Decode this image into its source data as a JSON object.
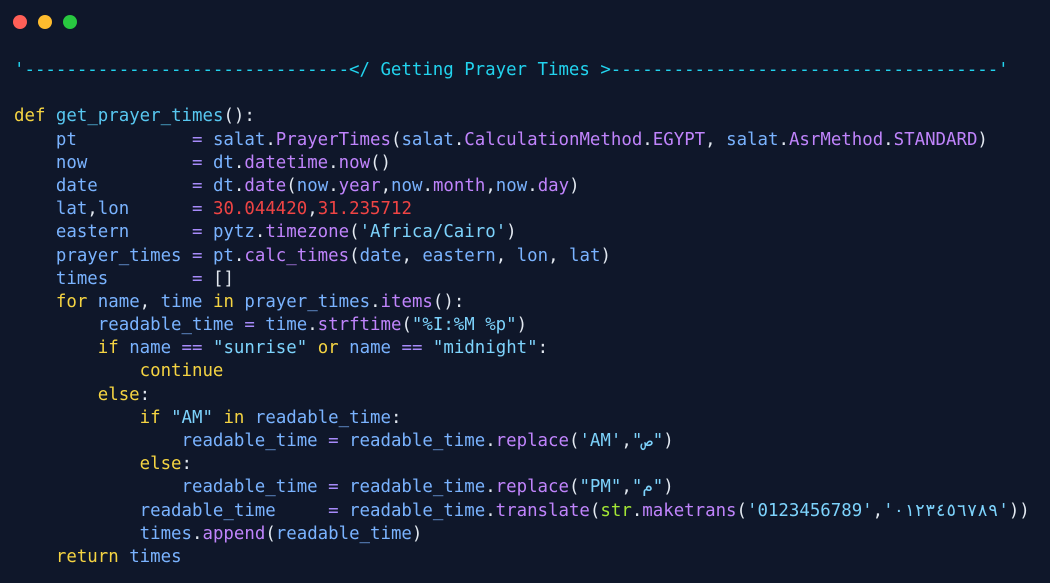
{
  "window": {
    "background": "#0f172a",
    "controls": [
      {
        "name": "close",
        "color": "#ff5f57"
      },
      {
        "name": "minimize",
        "color": "#febc2e"
      },
      {
        "name": "maximize",
        "color": "#28c840"
      }
    ]
  },
  "colors": {
    "keyword": "#f5d442",
    "function": "#58c7f0",
    "name": "#7ab3ff",
    "member": "#c084fc",
    "string": "#7dd3fc",
    "number": "#ef4444",
    "punct": "#e2e8f0",
    "operator": "#a78bfa",
    "builtin": "#a3e635",
    "banner": "#22d3ee"
  },
  "code": {
    "language": "python",
    "lines": [
      [
        [
          "banner",
          "'-------------------------------</ Getting Prayer Times >-------------------------------------'"
        ]
      ],
      [],
      [
        [
          "keyword",
          "def"
        ],
        [
          "name",
          " "
        ],
        [
          "function",
          "get_prayer_times"
        ],
        [
          "punct",
          "():"
        ]
      ],
      [
        [
          "name",
          "    pt           "
        ],
        [
          "operator",
          "="
        ],
        [
          "name",
          " salat"
        ],
        [
          "punct",
          "."
        ],
        [
          "member",
          "PrayerTimes"
        ],
        [
          "punct",
          "("
        ],
        [
          "name",
          "salat"
        ],
        [
          "punct",
          "."
        ],
        [
          "member",
          "CalculationMethod"
        ],
        [
          "punct",
          "."
        ],
        [
          "member",
          "EGYPT"
        ],
        [
          "punct",
          ", "
        ],
        [
          "name",
          "salat"
        ],
        [
          "punct",
          "."
        ],
        [
          "member",
          "AsrMethod"
        ],
        [
          "punct",
          "."
        ],
        [
          "member",
          "STANDARD"
        ],
        [
          "punct",
          ")"
        ]
      ],
      [
        [
          "name",
          "    now          "
        ],
        [
          "operator",
          "="
        ],
        [
          "name",
          " dt"
        ],
        [
          "punct",
          "."
        ],
        [
          "member",
          "datetime"
        ],
        [
          "punct",
          "."
        ],
        [
          "member",
          "now"
        ],
        [
          "punct",
          "()"
        ]
      ],
      [
        [
          "name",
          "    date         "
        ],
        [
          "operator",
          "="
        ],
        [
          "name",
          " dt"
        ],
        [
          "punct",
          "."
        ],
        [
          "member",
          "date"
        ],
        [
          "punct",
          "("
        ],
        [
          "name",
          "now"
        ],
        [
          "punct",
          "."
        ],
        [
          "member",
          "year"
        ],
        [
          "punct",
          ","
        ],
        [
          "name",
          "now"
        ],
        [
          "punct",
          "."
        ],
        [
          "member",
          "month"
        ],
        [
          "punct",
          ","
        ],
        [
          "name",
          "now"
        ],
        [
          "punct",
          "."
        ],
        [
          "member",
          "day"
        ],
        [
          "punct",
          ")"
        ]
      ],
      [
        [
          "name",
          "    lat"
        ],
        [
          "punct",
          ","
        ],
        [
          "name",
          "lon      "
        ],
        [
          "operator",
          "="
        ],
        [
          "name",
          " "
        ],
        [
          "number",
          "30.044420"
        ],
        [
          "punct",
          ","
        ],
        [
          "number",
          "31.235712"
        ]
      ],
      [
        [
          "name",
          "    eastern      "
        ],
        [
          "operator",
          "="
        ],
        [
          "name",
          " pytz"
        ],
        [
          "punct",
          "."
        ],
        [
          "member",
          "timezone"
        ],
        [
          "punct",
          "("
        ],
        [
          "string",
          "'Africa/Cairo'"
        ],
        [
          "punct",
          ")"
        ]
      ],
      [
        [
          "name",
          "    prayer_times "
        ],
        [
          "operator",
          "="
        ],
        [
          "name",
          " pt"
        ],
        [
          "punct",
          "."
        ],
        [
          "member",
          "calc_times"
        ],
        [
          "punct",
          "("
        ],
        [
          "name",
          "date"
        ],
        [
          "punct",
          ", "
        ],
        [
          "name",
          "eastern"
        ],
        [
          "punct",
          ", "
        ],
        [
          "name",
          "lon"
        ],
        [
          "punct",
          ", "
        ],
        [
          "name",
          "lat"
        ],
        [
          "punct",
          ")"
        ]
      ],
      [
        [
          "name",
          "    times        "
        ],
        [
          "operator",
          "="
        ],
        [
          "name",
          " "
        ],
        [
          "punct",
          "[]"
        ]
      ],
      [
        [
          "name",
          "    "
        ],
        [
          "keyword",
          "for"
        ],
        [
          "name",
          " name"
        ],
        [
          "punct",
          ", "
        ],
        [
          "name",
          "time "
        ],
        [
          "keyword",
          "in"
        ],
        [
          "name",
          " prayer_times"
        ],
        [
          "punct",
          "."
        ],
        [
          "member",
          "items"
        ],
        [
          "punct",
          "():"
        ]
      ],
      [
        [
          "name",
          "        readable_time "
        ],
        [
          "operator",
          "="
        ],
        [
          "name",
          " time"
        ],
        [
          "punct",
          "."
        ],
        [
          "member",
          "strftime"
        ],
        [
          "punct",
          "("
        ],
        [
          "string",
          "\"%I:%M %p\""
        ],
        [
          "punct",
          ")"
        ]
      ],
      [
        [
          "name",
          "        "
        ],
        [
          "keyword",
          "if"
        ],
        [
          "name",
          " name "
        ],
        [
          "operator",
          "=="
        ],
        [
          "name",
          " "
        ],
        [
          "string",
          "\"sunrise\""
        ],
        [
          "name",
          " "
        ],
        [
          "keyword",
          "or"
        ],
        [
          "name",
          " name "
        ],
        [
          "operator",
          "=="
        ],
        [
          "name",
          " "
        ],
        [
          "string",
          "\"midnight\""
        ],
        [
          "punct",
          ":"
        ]
      ],
      [
        [
          "name",
          "            "
        ],
        [
          "keyword",
          "continue"
        ]
      ],
      [
        [
          "name",
          "        "
        ],
        [
          "keyword",
          "else"
        ],
        [
          "punct",
          ":"
        ]
      ],
      [
        [
          "name",
          "            "
        ],
        [
          "keyword",
          "if"
        ],
        [
          "name",
          " "
        ],
        [
          "string",
          "\"AM\""
        ],
        [
          "name",
          " "
        ],
        [
          "keyword",
          "in"
        ],
        [
          "name",
          " readable_time"
        ],
        [
          "punct",
          ":"
        ]
      ],
      [
        [
          "name",
          "                readable_time "
        ],
        [
          "operator",
          "="
        ],
        [
          "name",
          " readable_time"
        ],
        [
          "punct",
          "."
        ],
        [
          "member",
          "replace"
        ],
        [
          "punct",
          "("
        ],
        [
          "string",
          "'AM'"
        ],
        [
          "punct",
          ","
        ],
        [
          "string",
          "\"ص\""
        ],
        [
          "punct",
          ")"
        ]
      ],
      [
        [
          "name",
          "            "
        ],
        [
          "keyword",
          "else"
        ],
        [
          "punct",
          ":"
        ]
      ],
      [
        [
          "name",
          "                readable_time "
        ],
        [
          "operator",
          "="
        ],
        [
          "name",
          " readable_time"
        ],
        [
          "punct",
          "."
        ],
        [
          "member",
          "replace"
        ],
        [
          "punct",
          "("
        ],
        [
          "string",
          "\"PM\""
        ],
        [
          "punct",
          ","
        ],
        [
          "string",
          "\"م\""
        ],
        [
          "punct",
          ")"
        ]
      ],
      [
        [
          "name",
          "            readable_time     "
        ],
        [
          "operator",
          "="
        ],
        [
          "name",
          " readable_time"
        ],
        [
          "punct",
          "."
        ],
        [
          "member",
          "translate"
        ],
        [
          "punct",
          "("
        ],
        [
          "builtin",
          "str"
        ],
        [
          "punct",
          "."
        ],
        [
          "member",
          "maketrans"
        ],
        [
          "punct",
          "("
        ],
        [
          "string",
          "'0123456789'"
        ],
        [
          "punct",
          ","
        ],
        [
          "string",
          "'٠١٢٣٤٥٦٧٨٩'"
        ],
        [
          "punct",
          "))"
        ]
      ],
      [
        [
          "name",
          "            times"
        ],
        [
          "punct",
          "."
        ],
        [
          "member",
          "append"
        ],
        [
          "punct",
          "("
        ],
        [
          "name",
          "readable_time"
        ],
        [
          "punct",
          ")"
        ]
      ],
      [
        [
          "name",
          "    "
        ],
        [
          "keyword",
          "return"
        ],
        [
          "name",
          " times"
        ]
      ]
    ]
  }
}
